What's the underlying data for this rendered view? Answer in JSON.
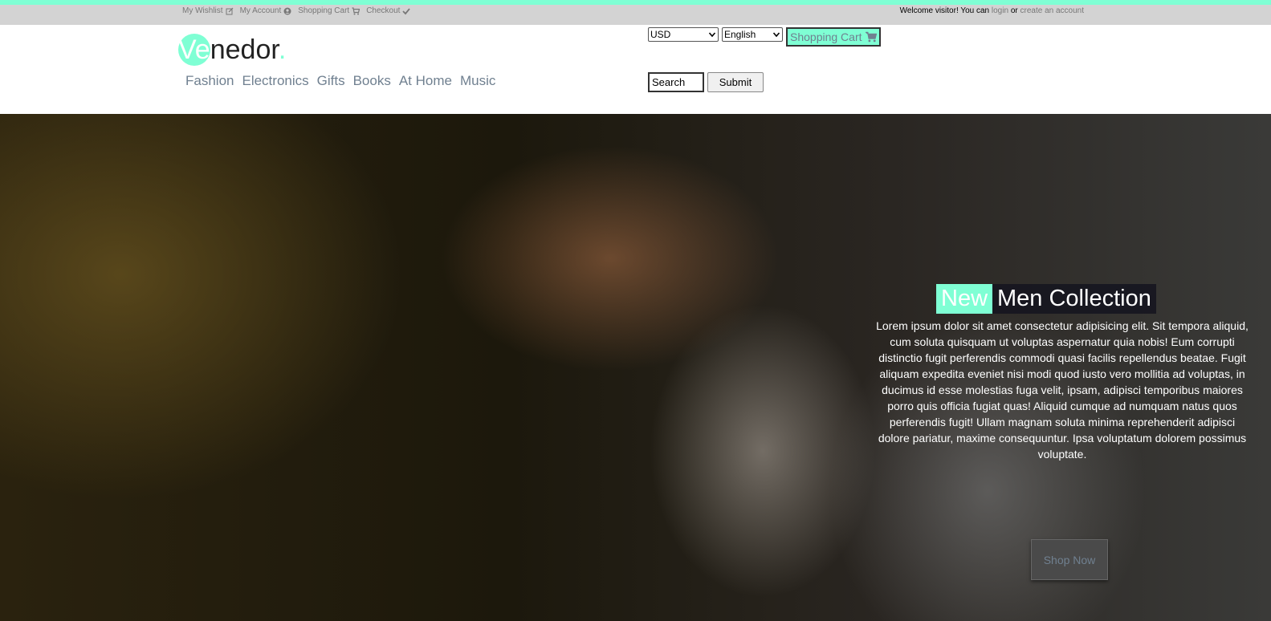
{
  "topbar": {
    "links": [
      {
        "label": "My Wishlist",
        "icon": "edit-icon"
      },
      {
        "label": "My Account",
        "icon": "user-circle-icon"
      },
      {
        "label": "Shopping Cart",
        "icon": "cart-icon"
      },
      {
        "label": "Checkout",
        "icon": "check-icon"
      }
    ],
    "welcome_prefix": "Welcome visitor! You can",
    "login_label": "login",
    "or_label": "or",
    "create_account_label": "create an account"
  },
  "logo": {
    "ve": "Ve",
    "rest": "nedor",
    "dot": "."
  },
  "nav": {
    "items": [
      "Fashion",
      "Electronics",
      "Gifts",
      "Books",
      "At Home",
      "Music"
    ]
  },
  "controls": {
    "currency": "USD",
    "language": "English",
    "cart_label": "Shopping Cart",
    "cart_icon": "cart-icon"
  },
  "search": {
    "value": "Search",
    "submit_label": "Submit"
  },
  "hero": {
    "title_highlight": "New",
    "title_rest": "Men Collection",
    "text": "Lorem ipsum dolor sit amet consectetur adipisicing elit. Sit tempora aliquid, cum soluta quisquam ut voluptas aspernatur quia nobis! Eum corrupti distinctio fugit perferendis commodi quasi facilis repellendus beatae. Fugit aliquam expedita eveniet nisi modi quod iusto vero mollitia ad voluptas, in ducimus id esse molestias fuga velit, ipsam, adipisci temporibus maiores porro quis officia fugiat quas! Aliquid cumque ad numquam natus quos perferendis fugit! Ullam magnam soluta minima reprehenderit adipisci dolore pariatur, maxime consequuntur. Ipsa voluptatum dolorem possimus voluptate.",
    "shop_now_label": "Shop Now"
  },
  "colors": {
    "accent": "#7fffd4",
    "nav_text": "#708090",
    "topbar_bg": "#d3d3d3"
  }
}
